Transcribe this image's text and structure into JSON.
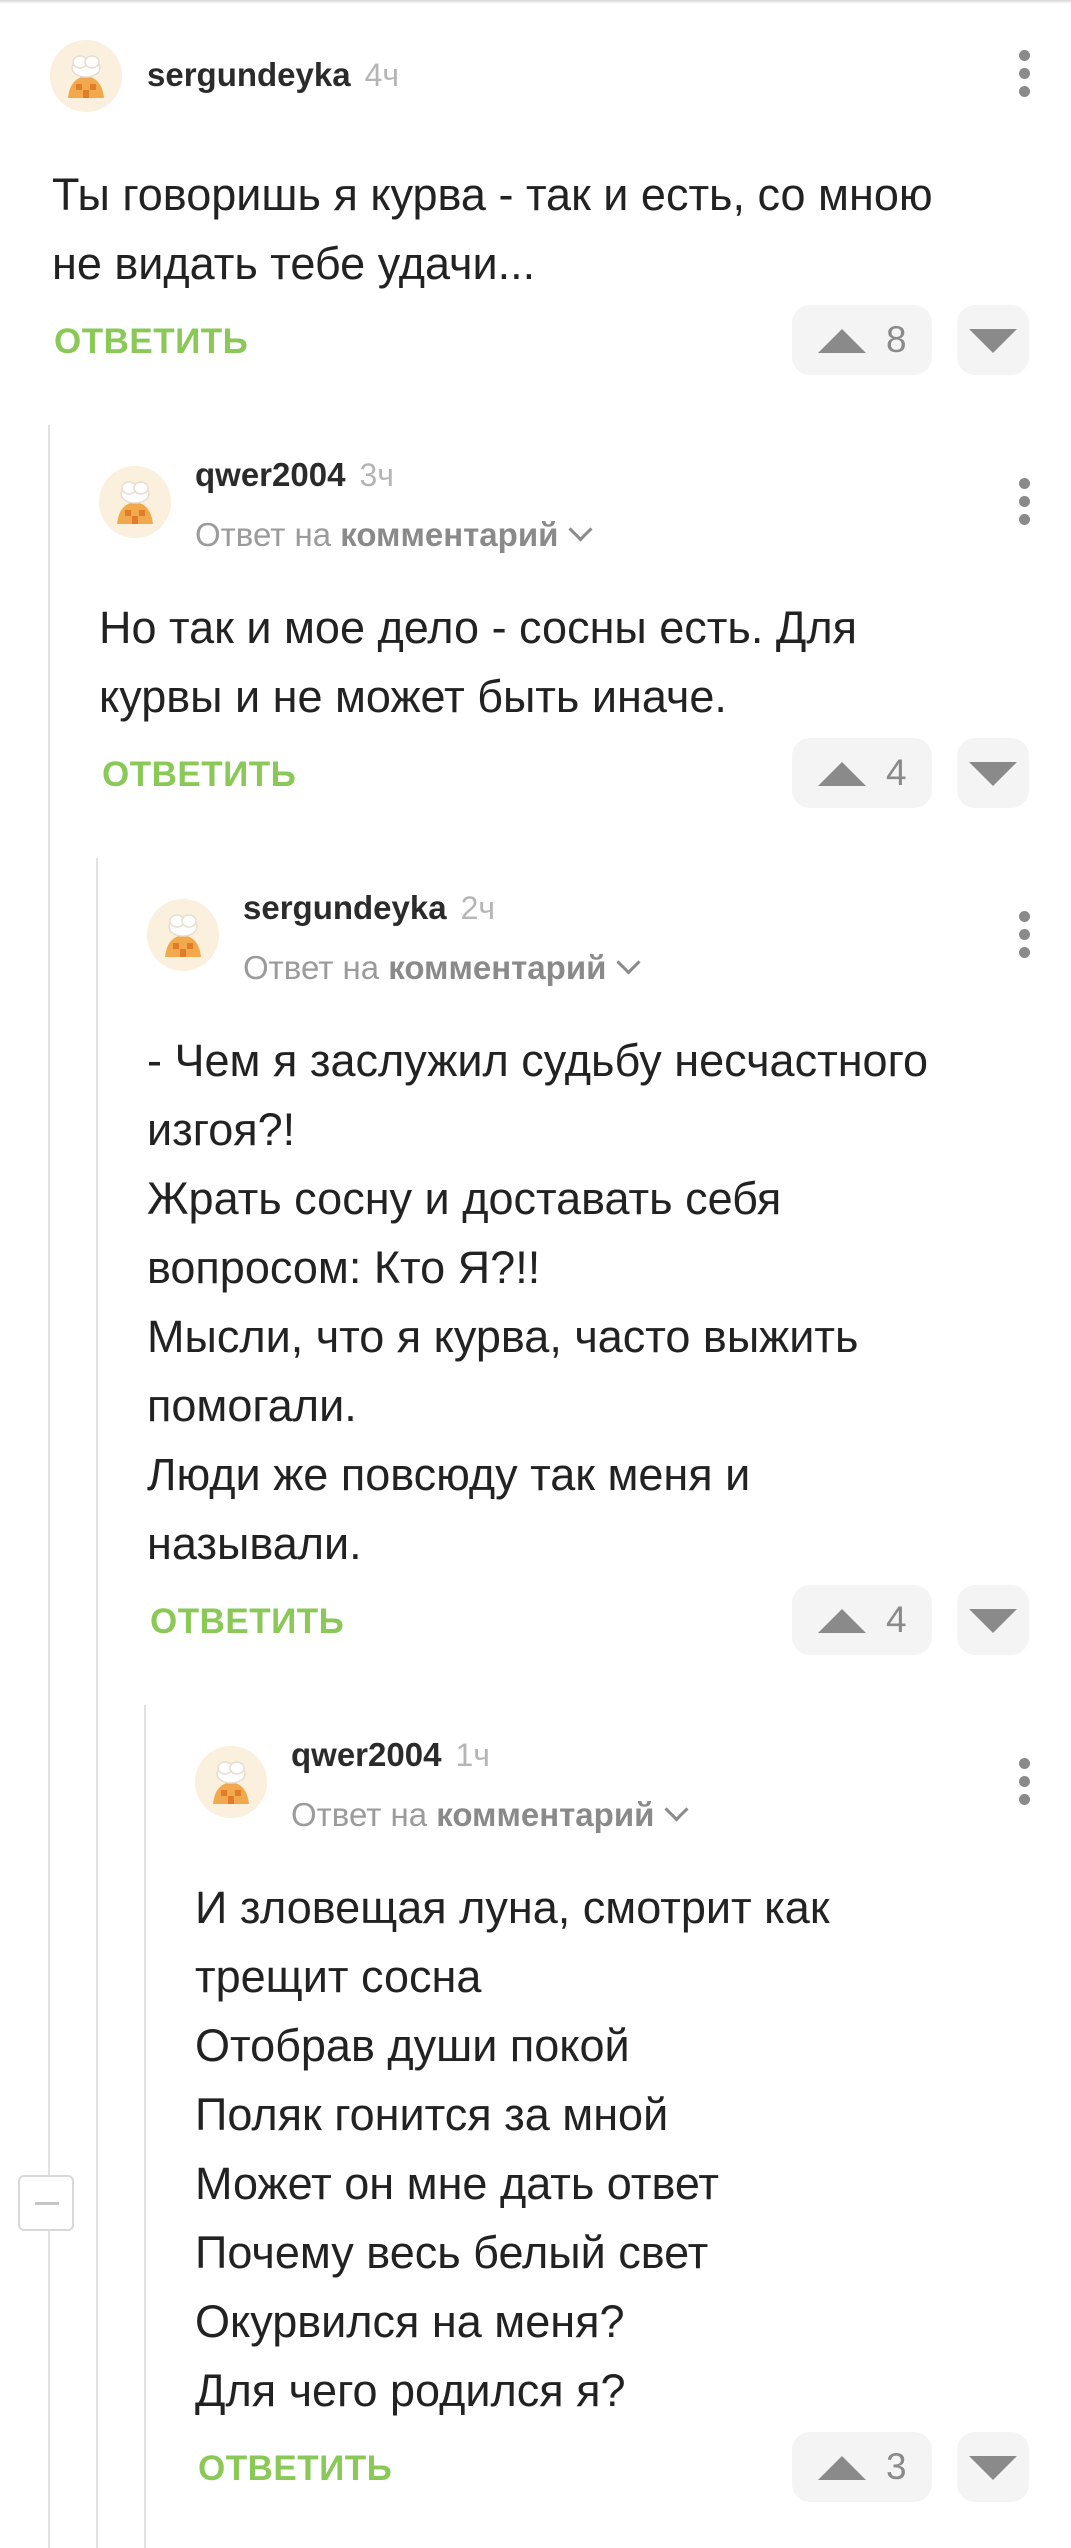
{
  "comments": [
    {
      "username": "sergundeyka",
      "time": "4ч",
      "reply_prefix": "",
      "reply_link": "",
      "text": "Ты говоришь я курва - так и есть, со мною\nне видать тебе удачи...",
      "reply_label": "ОТВЕТИТЬ",
      "votes": "8"
    },
    {
      "username": "qwer2004",
      "time": "3ч",
      "reply_prefix": "Ответ на ",
      "reply_link": "комментарий",
      "text": "Но так и мое дело - сосны есть. Для\nкурвы и не может быть иначе.",
      "reply_label": "ОТВЕТИТЬ",
      "votes": "4"
    },
    {
      "username": "sergundeyka",
      "time": "2ч",
      "reply_prefix": "Ответ на ",
      "reply_link": "комментарий",
      "text": "- Чем я заслужил судьбу несчастного\nизгоя?!\nЖрать сосну и доставать себя\nвопросом: Кто Я?!!\nМысли, что я курва, часто выжить\nпомогали.\nЛюди же повсюду так меня и\nназывали.",
      "reply_label": "ОТВЕТИТЬ",
      "votes": "4"
    },
    {
      "username": "qwer2004",
      "time": "1ч",
      "reply_prefix": "Ответ на ",
      "reply_link": "комментарий",
      "text": "И зловещая луна, смотрит как\nтрещит сосна\nОтобрав души покой\nПоляк гонится за мной\nМожет он мне дать ответ\nПочему весь белый свет\nОкурвился на меня?\nДля чего родился я?",
      "reply_label": "ОТВЕТИТЬ",
      "votes": "3"
    }
  ]
}
